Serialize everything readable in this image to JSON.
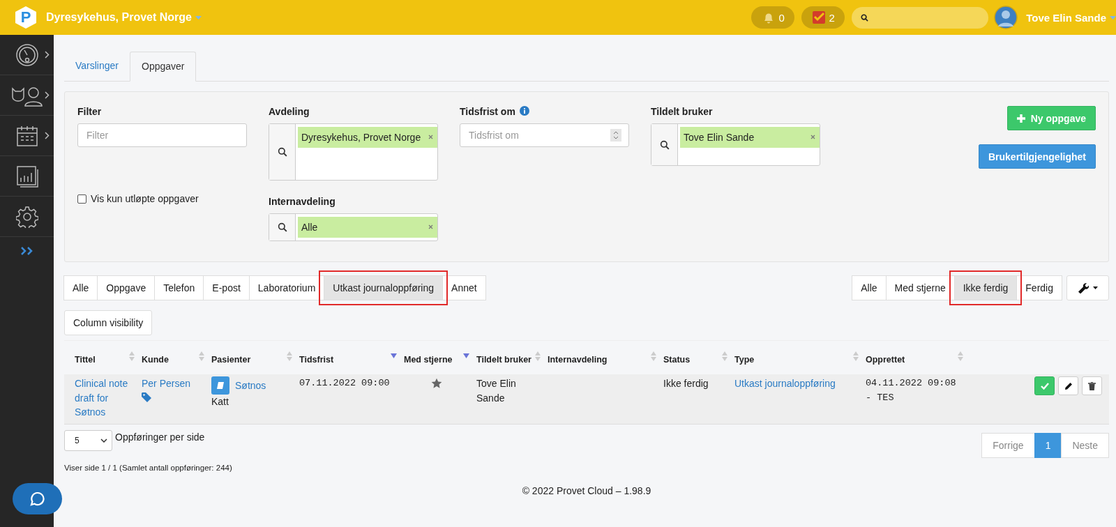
{
  "header": {
    "logo_letter": "P",
    "org_name": "Dyresykehus, Provet Norge",
    "notifications_count": "0",
    "tasks_count": "2",
    "user_name": "Tove Elin Sande"
  },
  "sidebar": {
    "items": [
      {
        "kind": "gauge",
        "has_submenu": true
      },
      {
        "kind": "pets",
        "has_submenu": true
      },
      {
        "kind": "calendar",
        "has_submenu": true
      },
      {
        "kind": "chart",
        "has_submenu": false
      },
      {
        "kind": "gear",
        "has_submenu": false
      },
      {
        "kind": "expand",
        "has_submenu": false
      }
    ]
  },
  "tabs": [
    {
      "label": "Varslinger",
      "selected": false
    },
    {
      "label": "Oppgaver",
      "selected": true
    }
  ],
  "filters": {
    "filter": {
      "label": "Filter",
      "placeholder": "Filter"
    },
    "avdeling": {
      "label": "Avdeling",
      "tags": [
        "Dyresykehus, Provet Norge"
      ]
    },
    "tidsfrist": {
      "label": "Tidsfrist om",
      "placeholder": "Tidsfrist om"
    },
    "tildelt": {
      "label": "Tildelt bruker",
      "tags": [
        "Tove Elin Sande"
      ]
    },
    "internavdeling": {
      "label": "Internavdeling",
      "tags": [
        "Alle"
      ]
    },
    "expired_only": {
      "label": "Vis kun utløpte oppgaver",
      "checked": false
    },
    "new_task_button": "Ny oppgave",
    "availability_button": "Brukertilgjengelighet"
  },
  "type_filters": [
    {
      "label": "Alle",
      "selected": false
    },
    {
      "label": "Oppgave",
      "selected": false
    },
    {
      "label": "Telefon",
      "selected": false
    },
    {
      "label": "E-post",
      "selected": false
    },
    {
      "label": "Laboratorium",
      "selected": false
    },
    {
      "label": "Utkast journaloppføring",
      "selected": true
    },
    {
      "label": "Annet",
      "selected": false
    }
  ],
  "status_filters": [
    {
      "label": "Alle",
      "selected": false
    },
    {
      "label": "Med stjerne",
      "selected": false
    },
    {
      "label": "Ikke ferdig",
      "selected": true
    },
    {
      "label": "Ferdig",
      "selected": false
    }
  ],
  "column_visibility": "Column visibility",
  "table": {
    "columns": [
      {
        "label": "Tittel",
        "sorted_desc": false
      },
      {
        "label": "Kunde",
        "sorted_desc": false
      },
      {
        "label": "Pasienter",
        "sorted_desc": false
      },
      {
        "label": "Tidsfrist",
        "sorted_desc": true
      },
      {
        "label": "Med stjerne",
        "sorted_desc": true
      },
      {
        "label": "Tildelt bruker",
        "sorted_desc": false
      },
      {
        "label": "Internavdeling",
        "sorted_desc": false
      },
      {
        "label": "Status",
        "sorted_desc": false
      },
      {
        "label": "Type",
        "sorted_desc": false
      },
      {
        "label": "Opprettet",
        "sorted_desc": false
      }
    ],
    "rows": [
      {
        "title": "Clinical note draft for Søtnos",
        "customer": "Per Persen",
        "patient": "Søtnos",
        "species": "Katt",
        "deadline": "07.11.2022 09:00",
        "starred": true,
        "assigned": "Tove Elin Sande",
        "status": "Ikke ferdig",
        "type": "Utkast journaloppføring",
        "created": "04.11.2022 09:08 - TES"
      }
    ]
  },
  "pagination": {
    "page_size": "5",
    "per_page_label": "Oppføringer per side",
    "previous": "Forrige",
    "pages": [
      {
        "label": "1",
        "selected": true
      }
    ],
    "next": "Neste"
  },
  "info": "Viser side 1 / 1 (Samlet antall oppføringer: 244)",
  "footer": "© 2022 Provet Cloud – 1.98.9"
}
